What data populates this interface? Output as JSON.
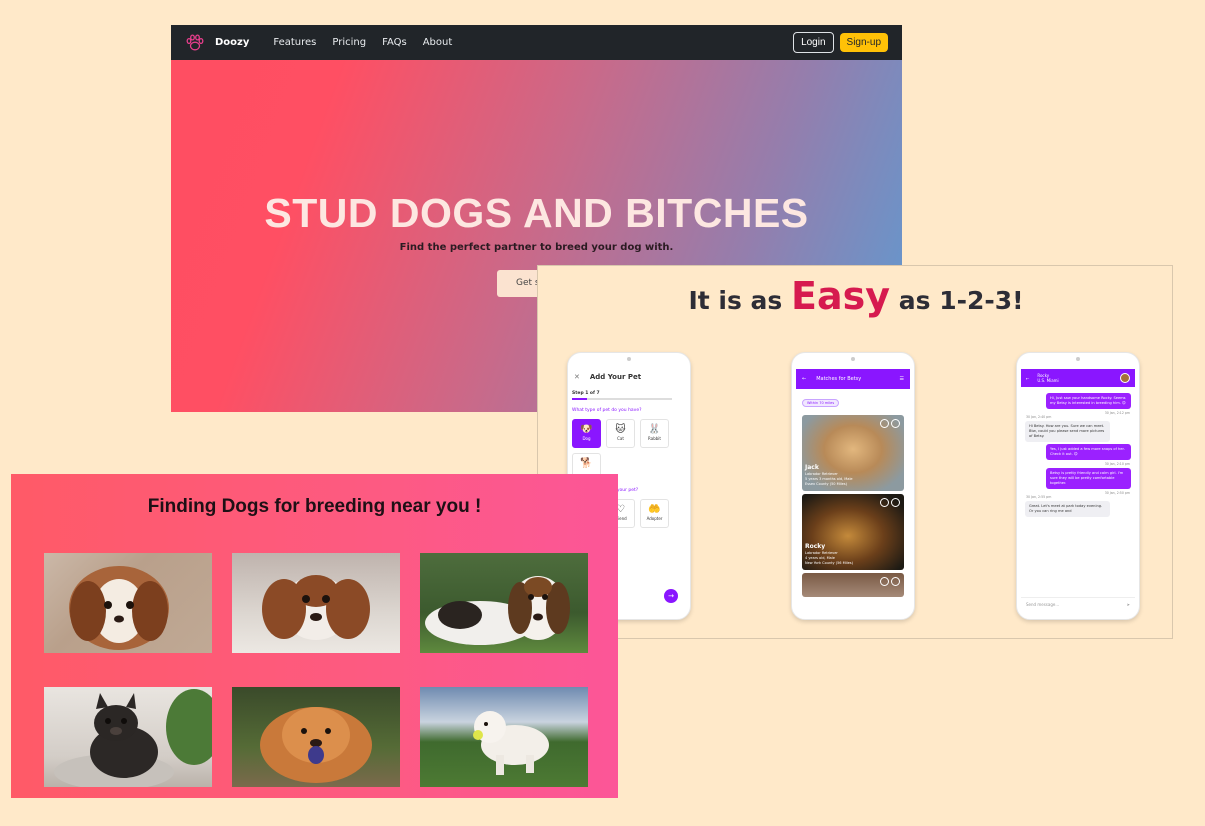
{
  "hero": {
    "brand": "Doozy",
    "nav": [
      "Features",
      "Pricing",
      "FAQs",
      "About"
    ],
    "login_label": "Login",
    "signup_label": "Sign-up",
    "title": "STUD DOGS AND BITCHES",
    "subtitle": "Find the perfect partner to breed your dog with.",
    "cta_label": "Get st",
    "colors": {
      "navbar": "#212529",
      "signup": "#ffc107",
      "gradient_start": "#ff4e62",
      "gradient_end": "#5d9bd2"
    }
  },
  "easy": {
    "title_before": "It is as",
    "title_highlight": "Easy",
    "title_after": "as 1-2-3!",
    "highlight_color": "#d61a4f",
    "phone1": {
      "title": "Add Your Pet",
      "step": "Step 1 of 7",
      "question": "What type of pet do you have?",
      "pet_types": [
        "Dog",
        "Cat",
        "Rabbit"
      ],
      "question2": "t for your pet?",
      "purposes": [
        "Friend",
        "Adopter"
      ]
    },
    "phone2": {
      "title": "Matches for Betsy",
      "filter": "Within 70 miles",
      "cards": [
        {
          "name": "Jack",
          "breed": "Labrador Retriever",
          "age": "5 years 3 months old, Male",
          "location": "Essex County (50 Miles)"
        },
        {
          "name": "Rocky",
          "breed": "Labrador Retriever",
          "age": "4 years old, Male",
          "location": "New York County (56 Miles)"
        }
      ]
    },
    "phone3": {
      "name": "Rocky",
      "status": "U.S. Miami",
      "messages": [
        {
          "dir": "out",
          "text": "Hi, Just saw your handsome Rocky. Seems my Betsy is interested in breeding him. 😊",
          "time": "30 Jan, 2:12 pm"
        },
        {
          "dir": "in",
          "text": "Hi Betsy. How are you. Sure we can meet. Btw, could you please send more pictures of Betsy.",
          "time": "30 Jan, 2:40 pm"
        },
        {
          "dir": "out",
          "text": "Yes, I just added a few more snaps of her. Check it out. 😊",
          "time": "30 Jan, 2:10 pm"
        },
        {
          "dir": "out",
          "text": "Betsy is pretty friendly and calm girl. I'm sure they will be pretty comfortable together.",
          "time": "30 Jan, 2:50 pm"
        },
        {
          "dir": "in",
          "text": "Great. Let's meet at park today evening. Or you can ring me and",
          "time": "30 Jan, 2:55 pm"
        }
      ],
      "input_placeholder": "Send message..."
    }
  },
  "find": {
    "title": "Finding Dogs for breeding near you !",
    "photos": [
      "cavalier-king-charles-spaniel",
      "cavalier-puppy-lying",
      "basset-hound-puppy",
      "french-bulldog",
      "chow-chow",
      "white-poodle-running"
    ]
  }
}
